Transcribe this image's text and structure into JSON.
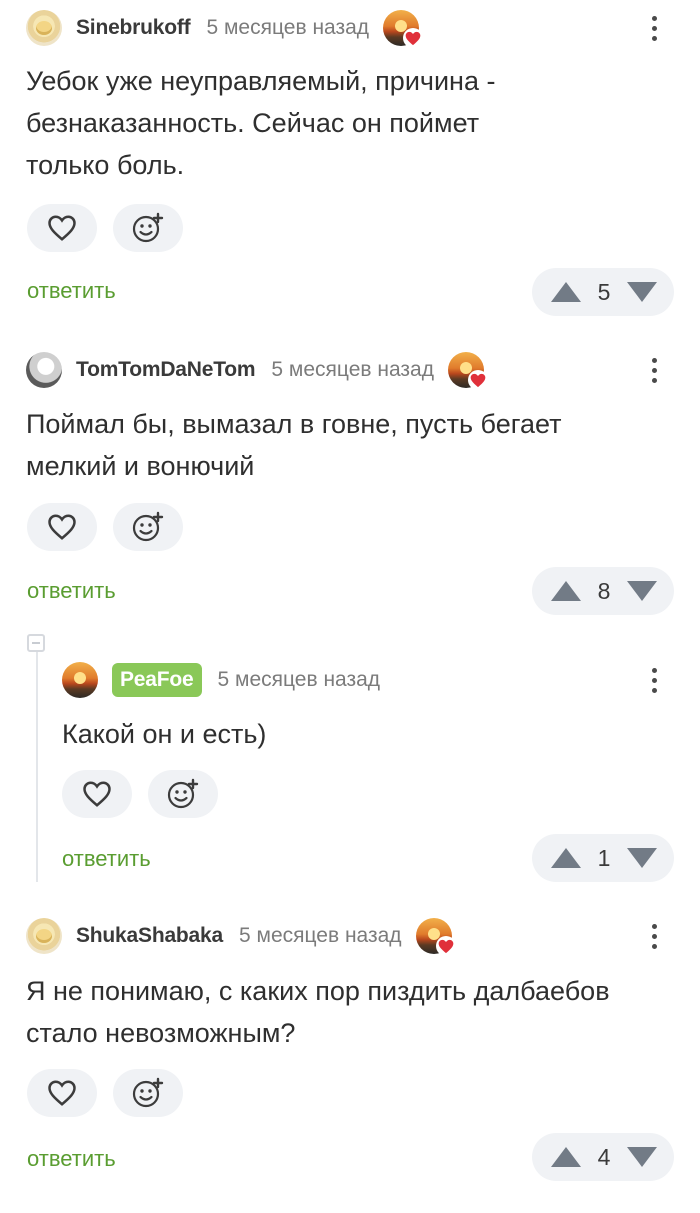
{
  "comments": [
    {
      "username": "Sinebrukoff",
      "time": "5 месяцев назад",
      "text": [
        "Уебок уже неуправляемый, причина -",
        "безнаказанность. Сейчас он поймет",
        "только боль."
      ],
      "reply_label": "ответить",
      "rating": "5"
    },
    {
      "username": "TomTomDaNeTom",
      "time": "5 месяцев назад",
      "text": [
        "Поймал бы, вымазал в говне, пусть бегает",
        "мелкий и вонючий"
      ],
      "reply_label": "ответить",
      "rating": "8"
    },
    {
      "username": "PeaFoe",
      "time": "5 месяцев назад",
      "text": [
        "Какой он и есть)"
      ],
      "reply_label": "ответить",
      "rating": "1"
    },
    {
      "username": "ShukaShabaka",
      "time": "5 месяцев назад",
      "text": [
        "Я не понимаю, с каких пор пиздить далбаебов",
        "стало невозможным?"
      ],
      "reply_label": "ответить",
      "rating": "4"
    }
  ],
  "colors": {
    "reply_green": "#5a9d31",
    "author_badge": "#8ac858",
    "pill_bg": "#f0f2f5",
    "heart_red": "#e0303a"
  },
  "icons": [
    "heart-icon",
    "emoji-add-icon",
    "upvote-icon",
    "downvote-icon",
    "more-options-icon",
    "collapse-icon"
  ]
}
